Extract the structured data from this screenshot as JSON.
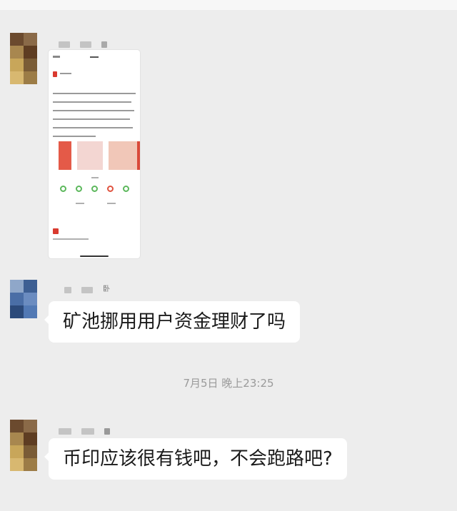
{
  "messages": [
    {
      "type": "image",
      "description_icons": [
        "share-icon",
        "wechat-icon",
        "moments-icon",
        "weibo-icon",
        "qq-icon"
      ]
    },
    {
      "type": "text",
      "text": "矿池挪用用户资金理财了吗"
    },
    {
      "type": "text",
      "text": "币印应该很有钱吧，不会跑路吧?"
    }
  ],
  "timestamp": "7月5日 晚上23:25",
  "colors": {
    "chat_background": "#ededed",
    "bubble": "#ffffff",
    "timestamp_text": "#9a9a9a",
    "accent_red": "#d93a2f",
    "accent_green": "#5cb85c"
  }
}
